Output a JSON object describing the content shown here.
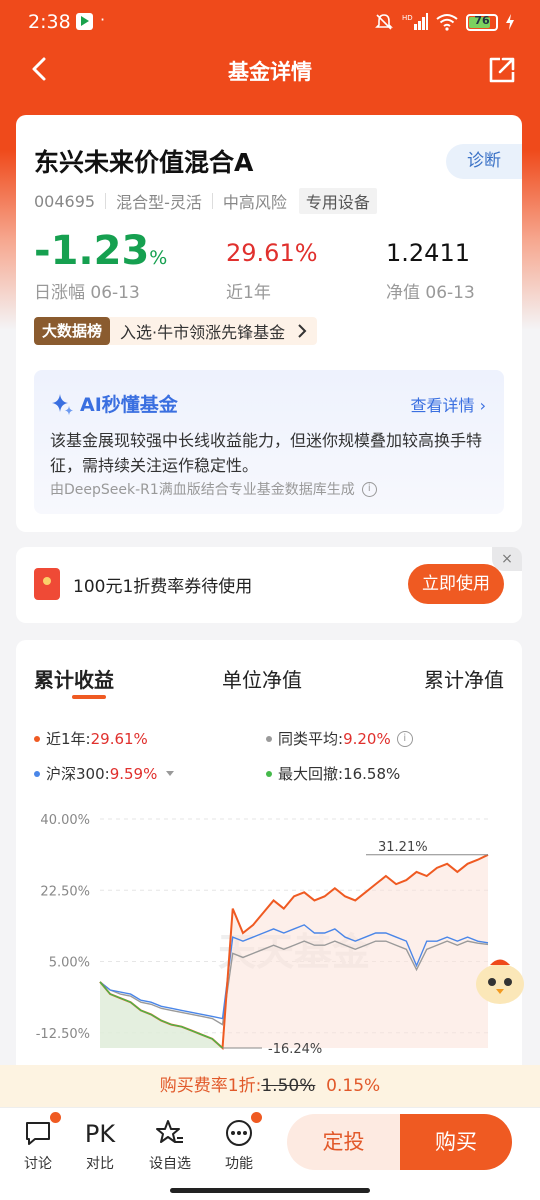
{
  "status": {
    "time": "2:38",
    "dot": "·",
    "battery": "76"
  },
  "nav": {
    "title": "基金详情"
  },
  "fund": {
    "name": "东兴未来价值混合A",
    "diagnose": "诊断",
    "code": "004695",
    "type": "混合型-灵活",
    "risk": "中高风险",
    "tag": "专用设备",
    "daily_change": "-1.23",
    "daily_change_unit": "%",
    "daily_label": "日涨幅 06-13",
    "year_return": "29.61%",
    "year_label": "近1年",
    "nav_value": "1.2411",
    "nav_label": "净值 06-13",
    "rank_badge": "大数据榜",
    "rank_text": "入选·牛市领涨先锋基金"
  },
  "ai": {
    "title": "AI秒懂基金",
    "more": "查看详情",
    "body": "该基金展现较强中长线收益能力，但迷你规模叠加较高换手特征，需持续关注运作稳定性。",
    "source": "由DeepSeek-R1满血版结合专业基金数据库生成"
  },
  "coupon": {
    "text": "100元1折费率券待使用",
    "button": "立即使用",
    "close": "×"
  },
  "tabs": [
    "累计收益",
    "单位净值",
    "累计净值"
  ],
  "legend": {
    "fund_label": "近1年:",
    "fund_value": "29.61%",
    "peer_label": "同类平均:",
    "peer_value": "9.20%",
    "index_label": "沪深300:",
    "index_value": "9.59%",
    "drawdown_label": "最大回撤:",
    "drawdown_value": "16.58%"
  },
  "colors": {
    "fund": "#ef5a22",
    "peer": "#9a9a9a",
    "index": "#4a86e8",
    "drawdown": "#44b94a",
    "brand": "#ef4a1b"
  },
  "chart_data": {
    "type": "line",
    "ylim": [
      -16.24,
      40
    ],
    "y_ticks": [
      "40.00%",
      "22.50%",
      "5.00%",
      "-12.50%"
    ],
    "y_tick_values": [
      40,
      22.5,
      5,
      -12.5
    ],
    "watermark": "天天基金",
    "annotations": {
      "max": "31.21%",
      "min": "-16.24%"
    },
    "series": [
      {
        "name": "近1年",
        "values": [
          0,
          -3,
          -4,
          -5,
          -7,
          -8,
          -9.5,
          -10.5,
          -11,
          -12,
          -13,
          -14,
          -16.24,
          18,
          12,
          14,
          17,
          20,
          18,
          21,
          22,
          20,
          21,
          23,
          21,
          20,
          22,
          24,
          26,
          24,
          25,
          27,
          26,
          28,
          29,
          27,
          29,
          30,
          31.21
        ]
      },
      {
        "name": "同类平均",
        "values": [
          0,
          -2,
          -3,
          -3.5,
          -5,
          -5.5,
          -6.5,
          -7,
          -7.5,
          -8,
          -8.5,
          -9,
          -10.5,
          7,
          6,
          7,
          8,
          9,
          8,
          9,
          10,
          9,
          9,
          10,
          9,
          8,
          9,
          10,
          10,
          9,
          8,
          3,
          8,
          9,
          10,
          9,
          10,
          9.5,
          9.2
        ]
      },
      {
        "name": "沪深300",
        "values": [
          0,
          -2,
          -2.5,
          -3,
          -4.5,
          -5,
          -6,
          -6.5,
          -7,
          -7.5,
          -8,
          -8.5,
          -9,
          11,
          10,
          11,
          12,
          13,
          12,
          13,
          14,
          12,
          12,
          13,
          11,
          10,
          11,
          12,
          12,
          11,
          10,
          4,
          10,
          10,
          11,
          10,
          11,
          10,
          9.59
        ]
      },
      {
        "name": "最大回撤",
        "values": [
          0,
          -3,
          -4,
          -5,
          -7,
          -8,
          -9.5,
          -10.5,
          -11,
          -12,
          -13,
          -14,
          -16.24
        ]
      }
    ]
  },
  "fee": {
    "label": "购买费率1折:",
    "old": "1.50%",
    "new": "0.15%"
  },
  "bottom": {
    "discuss": "讨论",
    "pk_icon": "PK",
    "pk": "对比",
    "fav": "设自选",
    "func": "功能",
    "dingtou": "定投",
    "buy": "购买"
  }
}
